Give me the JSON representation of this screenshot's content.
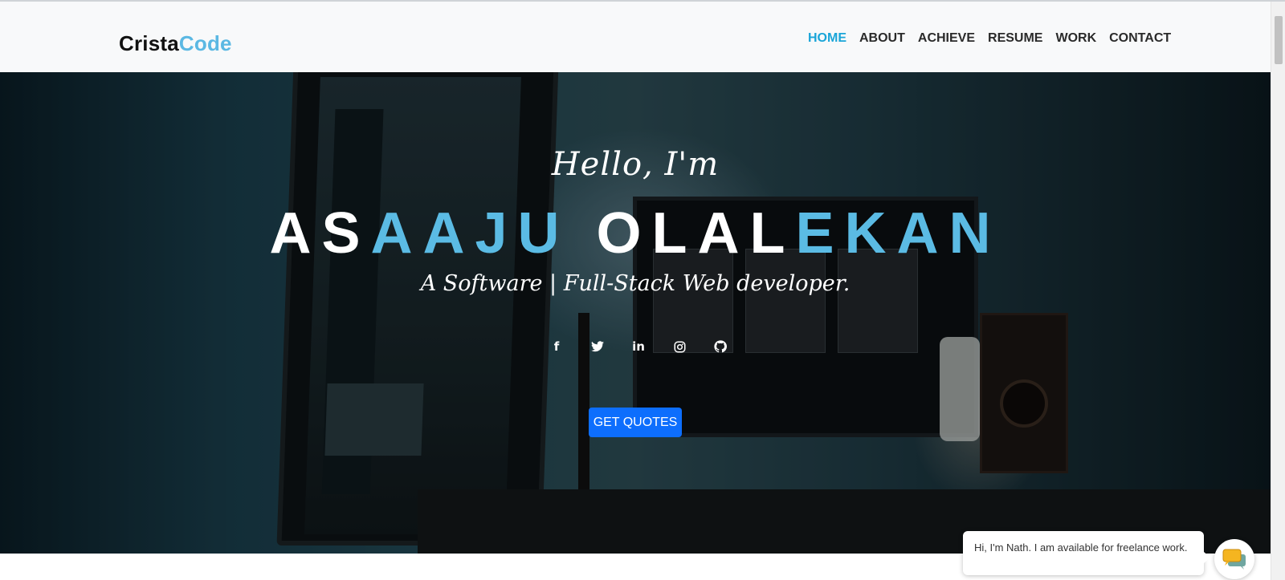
{
  "brand": {
    "part1": "Crista",
    "part2": "Code"
  },
  "nav": [
    {
      "label": "HOME",
      "active": true
    },
    {
      "label": "ABOUT"
    },
    {
      "label": "ACHIEVE"
    },
    {
      "label": "RESUME"
    },
    {
      "label": "WORK"
    },
    {
      "label": "CONTACT"
    }
  ],
  "hero": {
    "greeting": "Hello, I'm",
    "name": {
      "p1": "AS",
      "p2": "AAJU",
      "p3": "OLAL",
      "p4": "EKAN"
    },
    "tagline": "A Software | Full-Stack Web developer.",
    "socials": [
      {
        "icon": "facebook-icon",
        "glyph": "f"
      },
      {
        "icon": "twitter-icon",
        "glyph": "t"
      },
      {
        "icon": "linkedin-icon",
        "glyph": "in"
      },
      {
        "icon": "instagram-icon",
        "glyph": "◎"
      },
      {
        "icon": "github-icon",
        "glyph": "●"
      }
    ],
    "cta": "GET QUOTES"
  },
  "chat": {
    "message": "Hi, I'm Nath. I am available for freelance work."
  },
  "colors": {
    "accent": "#5bbbe4",
    "nav_active": "#1aa5d8",
    "button": "#0d6efd",
    "navbar_bg": "#f8f9fa"
  }
}
